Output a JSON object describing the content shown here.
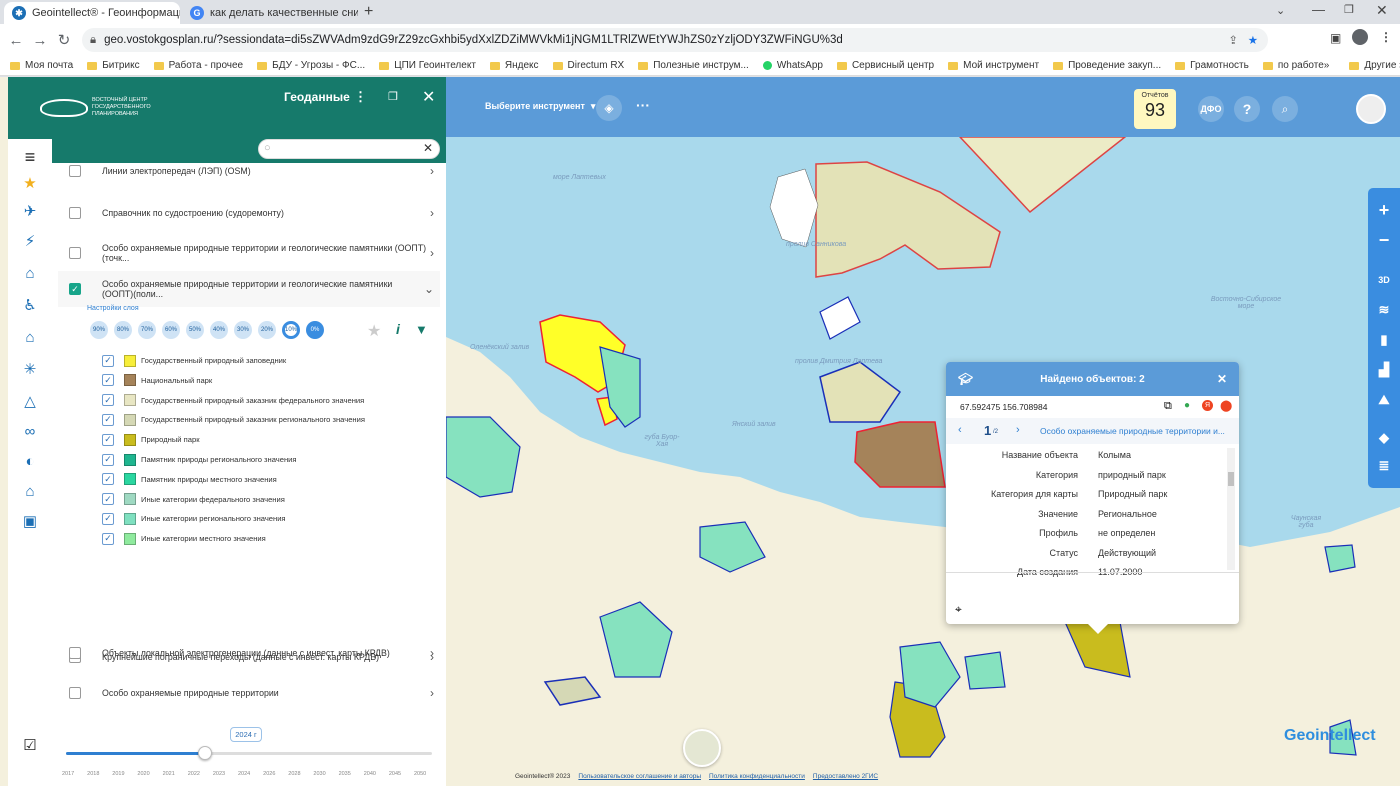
{
  "browser": {
    "tabs": [
      {
        "title": "Geointellect® - Геоинформацио...",
        "active": true
      },
      {
        "title": "как делать качественные снимк...",
        "active": false
      }
    ],
    "url": "geo.vostokgosplan.ru/?sessiondata=di5sZWVAdm9zdG9rZ29zcGxhbi5ydXxlZDZiMWVkMi1jNGM1LTRlZWEtYWJhZS0zYzljODY3ZWFiNGU%3d",
    "bookmarks": [
      "Моя почта",
      "Битрикс",
      "Работа - прочее",
      "БДУ - Угрозы - ФС...",
      "ЦПИ Геоинтелект",
      "Яндекс",
      "Directum RX",
      "Полезные инструм...",
      "WhatsApp",
      "Сервисный центр",
      "Мой инструмент",
      "Проведение закуп...",
      "Грамотность",
      "по работе"
    ],
    "bookmarks_more": "»",
    "other_bookmarks": "Другие закладки"
  },
  "header": {
    "logo_text": "ВОСТОЧНЫЙ ЦЕНТР ГОСУДАРСТВЕННОГО ПЛАНИРОВАНИЯ",
    "panel_title": "Геоданные",
    "tool_select": "Выберите инструмент",
    "reports_label": "Отчётов",
    "reports_count": "93",
    "dfo_label": "ДФО",
    "help_label": "?"
  },
  "layers": {
    "partial_top": "Линии электропередач (ЛЭП) (OSM)",
    "items": [
      {
        "label": "Справочник по судостроению (судоремонту)",
        "checked": false
      },
      {
        "label": "Особо охраняемые природные территории и геологические памятники (ООПТ)(точк...",
        "checked": false
      },
      {
        "label": "Особо охраняемые природные территории и геологические памятники (ООПТ)(поли...",
        "checked": true
      }
    ],
    "settings_label": "Настройки слоя",
    "opacity": [
      "90%",
      "80%",
      "70%",
      "60%",
      "50%",
      "40%",
      "30%",
      "20%",
      "10%",
      "0%"
    ],
    "opacity_selected": "10%",
    "info_label": "i",
    "legend": [
      {
        "label": "Государственный природный заповедник",
        "color": "#f7ee3a"
      },
      {
        "label": "Национальный парк",
        "color": "#a5835a"
      },
      {
        "label": "Государственный природный заказник федерального значения",
        "color": "#e8e6c3"
      },
      {
        "label": "Государственный природный заказник регионального значения",
        "color": "#d5d8b5"
      },
      {
        "label": "Природный парк",
        "color": "#c9bc1e"
      },
      {
        "label": "Памятник природы регионального значения",
        "color": "#1fb58f"
      },
      {
        "label": "Памятник природы местного значения",
        "color": "#2bd6a0"
      },
      {
        "label": "Иные категории федерального значения",
        "color": "#9fd9c2"
      },
      {
        "label": "Иные категории регионального значения",
        "color": "#7fe0c0"
      },
      {
        "label": "Иные категории местного значения",
        "color": "#8fea9e"
      }
    ],
    "below": [
      {
        "label": "Крупнейшие пограничные переходы (данные с инвест. карты КРДВ)",
        "checked": false
      },
      {
        "label": "Особо охраняемые природные территории",
        "checked": false
      },
      {
        "label": "Объекты локальной электрогенерации (данные с инвест. карты КРДВ)",
        "checked": false
      }
    ]
  },
  "timeline": {
    "current": "2024 г",
    "current_fraction": 0.38,
    "years": [
      "2017",
      "2018",
      "2019",
      "2020",
      "2021",
      "2022",
      "2023",
      "2024",
      "2026",
      "2028",
      "2030",
      "2035",
      "2040",
      "2045",
      "2050"
    ]
  },
  "popup": {
    "title": "Найдено объектов: 2",
    "coords": "67.592475 156.708984",
    "page_current": "1",
    "page_total": "/2",
    "layer_name": "Особо охраняемые природные территории и...",
    "attributes": [
      {
        "key": "Название объекта",
        "value": "Колыма"
      },
      {
        "key": "Категория",
        "value": "природный парк"
      },
      {
        "key": "Категория для карты",
        "value": "Природный парк"
      },
      {
        "key": "Значение",
        "value": "Региональное"
      },
      {
        "key": "Профиль",
        "value": "не определен"
      },
      {
        "key": "Статус",
        "value": "Действующий"
      },
      {
        "key": "Дата создания",
        "value": "11.07.2000"
      }
    ]
  },
  "map_labels": {
    "sea_laptev": "море Лаптевых",
    "strait_sannikov": "пролив Санникова",
    "strait_laptev": "пролив Дмитрия Лаптева",
    "east_siberian_sea": "Восточно-Сибирское море",
    "olenek_bay": "Оленёкский залив",
    "yana_bay": "Янский залив",
    "buor_khaya": "губа Буор-Хая",
    "chaun_bay": "Чаунская губа"
  },
  "right_toolbar": [
    "+",
    "−",
    "3D"
  ],
  "footer": {
    "copyright": "Geointellect® 2023",
    "links": [
      "Пользовательское соглашение и авторы",
      "Политика конфиденциальности",
      "Предоставлено 2ГИС"
    ]
  },
  "watermark": "Geointellect"
}
